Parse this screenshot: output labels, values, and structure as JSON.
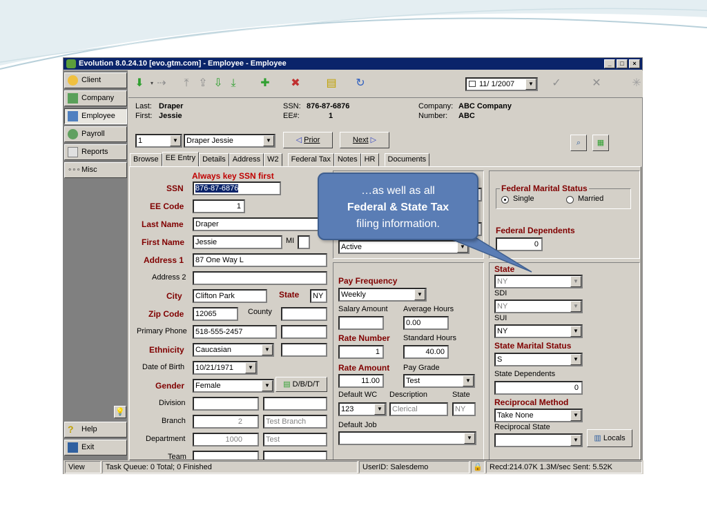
{
  "window": {
    "title": "Evolution 8.0.24.10 [evo.gtm.com] - Employee - Employee",
    "min": "_",
    "max": "□",
    "close": "×"
  },
  "sidebar": {
    "items": [
      {
        "label": "Client",
        "key": "l"
      },
      {
        "label": "Company",
        "key": "C"
      },
      {
        "label": "Employee",
        "key": "E"
      },
      {
        "label": "Payroll",
        "key": "y"
      },
      {
        "label": "Reports",
        "key": "R"
      },
      {
        "label": "Misc",
        "key": "M"
      }
    ],
    "help": "Help",
    "exit": "Exit"
  },
  "toolbar": {
    "date": "11/ 1/2007"
  },
  "header": {
    "last_label": "Last:",
    "last_value": "Draper",
    "first_label": "First:",
    "first_value": "Jessie",
    "ssn_label": "SSN:",
    "ssn_value": "876-87-6876",
    "ee_label": "EE#:",
    "ee_value": "1",
    "company_label": "Company:",
    "company_value": "ABC Company",
    "number_label": "Number:",
    "number_value": "ABC"
  },
  "nav": {
    "index": "1",
    "employee": "Draper Jessie",
    "prior": "Prior",
    "next": "Next"
  },
  "tabs": [
    "Browse",
    "EE Entry",
    "Details",
    "Address",
    "W2",
    "Federal Tax",
    "Notes",
    "HR",
    "Documents"
  ],
  "form": {
    "always_key": "Always key SSN first",
    "ssn_label": "SSN",
    "ssn_value": "876-87-6876",
    "eecode_label": "EE Code",
    "eecode_value": "1",
    "lastname_label": "Last Name",
    "lastname_value": "Draper",
    "firstname_label": "First Name",
    "firstname_value": "Jessie",
    "mi_label": "MI",
    "address1_label": "Address 1",
    "address1_value": "87 One Way L",
    "address2_label": "Address 2",
    "city_label": "City",
    "city_value": "Clifton Park",
    "state_label": "State",
    "state_value": "NY",
    "zip_label": "Zip Code",
    "zip_value": "12065",
    "county_label": "County",
    "phone_label": "Primary Phone",
    "phone_value": "518-555-2457",
    "ethnicity_label": "Ethnicity",
    "ethnicity_value": "Caucasian",
    "dob_label": "Date of Birth",
    "dob_value": "10/21/1971",
    "gender_label": "Gender",
    "gender_value": "Female",
    "dbdt": "D/B/D/T",
    "division_label": "Division",
    "branch_label": "Branch",
    "branch_value": "2",
    "branch_name": "Test Branch",
    "department_label": "Department",
    "department_value": "1000",
    "department_name": "Test",
    "team_label": "Team"
  },
  "middle": {
    "status_value": "Active",
    "payfreq_label": "Pay Frequency",
    "payfreq_value": "Weekly",
    "salary_label": "Salary Amount",
    "avghours_label": "Average Hours",
    "avghours_value": "0.00",
    "ratenum_label": "Rate Number",
    "ratenum_value": "1",
    "stdhours_label": "Standard Hours",
    "stdhours_value": "40.00",
    "rateamt_label": "Rate Amount",
    "rateamt_value": "11.00",
    "paygrade_label": "Pay Grade",
    "paygrade_value": "Test",
    "defwc_label": "Default WC",
    "defwc_value": "123",
    "desc_label": "Description",
    "desc_value": "Clerical",
    "wcstate_label": "State",
    "wcstate_value": "NY",
    "defjob_label": "Default Job"
  },
  "right": {
    "fedmarital_label": "Federal Marital Status",
    "single": "Single",
    "married": "Married",
    "feddep_label": "Federal Dependents",
    "feddep_value": "0",
    "state_label": "State",
    "state_value": "NY",
    "sdi_label": "SDI",
    "sdi_value": "NY",
    "sui_label": "SUI",
    "sui_value": "NY",
    "statemarital_label": "State Marital Status",
    "statemarital_value": "S",
    "statedep_label": "State Dependents",
    "statedep_value": "0",
    "recip_label": "Reciprocal Method",
    "recip_value": "Take None",
    "recipstate_label": "Reciprocal State",
    "locals": "Locals"
  },
  "status": {
    "view": "View",
    "queue": "Task Queue: 0 Total; 0 Finished",
    "user": "UserID: Salesdemo",
    "net": "Recd:214.07K  1.3M/sec  Sent: 5.52K"
  },
  "callout": {
    "line1": "…as well as all",
    "line2": "Federal  & State Tax",
    "line3": "filing information."
  },
  "colors": {
    "titlebar": "#0a246a",
    "required_label": "#800000",
    "callout": "#5a7db5"
  }
}
